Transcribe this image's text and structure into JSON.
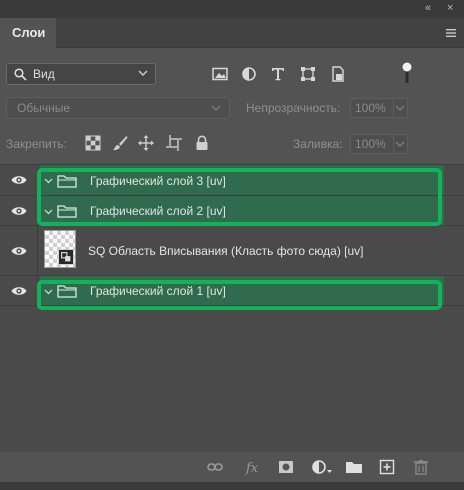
{
  "window": {
    "collapse": "«",
    "close": "×"
  },
  "panel": {
    "tab_label": "Слои"
  },
  "filter": {
    "kind_label": "Вид"
  },
  "blend": {
    "mode_label": "Обычные",
    "opacity_label": "Непрозрачность:",
    "opacity_value": "100%"
  },
  "lock": {
    "label": "Закрепить:",
    "fill_label": "Заливка:",
    "fill_value": "100%"
  },
  "layers": [
    {
      "name": "Графический слой 3 [uv]",
      "type": "group"
    },
    {
      "name": "Графический слой 2 [uv]",
      "type": "group"
    },
    {
      "name": "SQ Область Вписывания (Класть фото сюда) [uv]",
      "type": "smart-object"
    },
    {
      "name": "Графический слой 1 [uv]",
      "type": "group"
    }
  ],
  "icons": {
    "filter": [
      "image-filter-icon",
      "adjustment-filter-icon",
      "type-filter-icon",
      "shape-filter-icon",
      "smart-object-filter-icon"
    ],
    "lock": [
      "lock-transparency-icon",
      "lock-brush-icon",
      "lock-position-icon",
      "lock-artboard-icon",
      "lock-all-icon"
    ],
    "bottom": [
      "link-layers-icon",
      "fx-icon",
      "add-mask-icon",
      "adjustment-layer-icon",
      "new-group-icon",
      "new-layer-icon",
      "delete-icon"
    ]
  },
  "colors": {
    "highlight": "#11b25a",
    "group_bg": "#2f6b4c",
    "panel_bg": "#535353"
  }
}
